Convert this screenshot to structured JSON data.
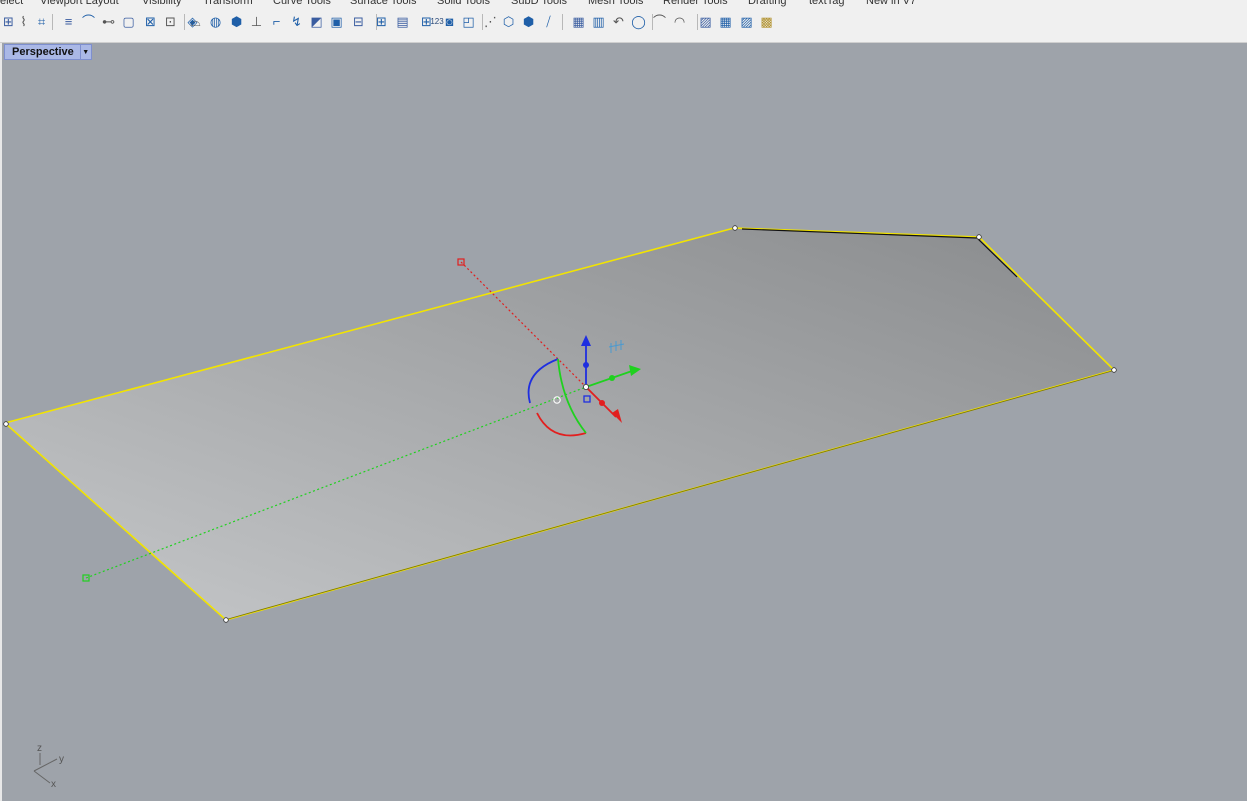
{
  "menu_tabs": [
    "elect",
    "Viewport Layout",
    "Visibility",
    "Transform",
    "Curve Tools",
    "Surface Tools",
    "Solid Tools",
    "SubD Tools",
    "Mesh Tools",
    "Render Tools",
    "Drafting",
    "textTag",
    "New in V7"
  ],
  "toolbar": {
    "icons": [
      "array-icon",
      "curve-fillet-icon",
      "trim-icon",
      "contour-icon",
      "offset-icon",
      "join-icon",
      "polyline-icon",
      "surface-grid-icon",
      "patch-icon",
      "loft-icon",
      "cylinder-icon",
      "sphere-icon",
      "box-icon",
      "extrude-icon",
      "pipe-icon",
      "sweep-icon",
      "boolean-icon",
      "cap-icon",
      "scale-icon",
      "point-grid-icon",
      "mesh-box-icon",
      "mesh-grid-icon",
      "text-number-icon",
      "mesh-solid-icon",
      "mesh-cube-icon",
      "points-icon",
      "mesh-polygon-icon",
      "mesh-sphere-icon",
      "mesh-slice-icon",
      "layout-grid-icon",
      "dimension-icon",
      "render-icon",
      "material-icon",
      "light-icon",
      "texture-icon",
      "rebuild-icon",
      "frame-icon",
      "camera-icon",
      "tag-icon"
    ],
    "text_number_label": "123"
  },
  "viewport": {
    "title": "Perspective",
    "menu_arrow": "▼"
  },
  "axis_labels": {
    "z": "z",
    "y": "y",
    "x": "x"
  },
  "colors": {
    "viewport_bg": "#9ea3aa",
    "selection": "#f2e400",
    "x_axis": "#e21f1f",
    "y_axis": "#1fd11f",
    "z_axis": "#1f2fe0",
    "tab_active": "#aab8e6"
  }
}
